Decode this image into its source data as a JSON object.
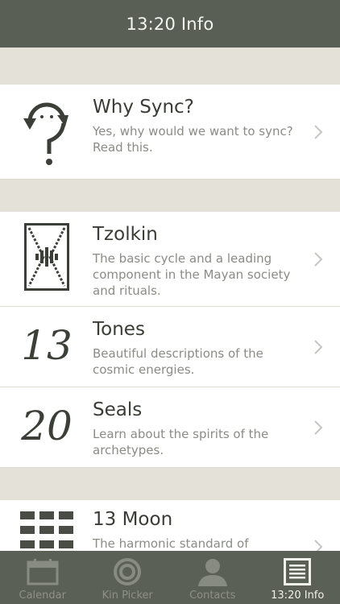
{
  "navbar": {
    "title": "13:20 Info"
  },
  "rows": [
    {
      "title": "Why Sync?",
      "desc": "Yes, why would we want to sync? Read this.",
      "icon": "sync-question-icon"
    },
    {
      "title": "Tzolkin",
      "desc": "The basic cycle and a leading component in the Mayan society and rituals.",
      "icon": "tzolkin-glyph-icon"
    },
    {
      "title": "Tones",
      "desc": "Beautiful descriptions of the cosmic energies.",
      "icon_text": "13"
    },
    {
      "title": "Seals",
      "desc": "Learn about the spirits of the archetypes.",
      "icon_text": "20"
    },
    {
      "title": "13 Moon",
      "desc": "The harmonic standard of",
      "icon": "calendar-grid-icon"
    }
  ],
  "tabs": [
    {
      "label": "Calendar",
      "icon": "calendar-icon",
      "active": false
    },
    {
      "label": "Kin Picker",
      "icon": "kin-picker-icon",
      "active": false
    },
    {
      "label": "Contacts",
      "icon": "contacts-icon",
      "active": false
    },
    {
      "label": "13:20 Info",
      "icon": "info-list-icon",
      "active": true
    }
  ],
  "colors": {
    "navbar": "#5a5f55",
    "tabbar": "#5b6056",
    "background": "#e4e2d9",
    "title_text": "#3a3d36",
    "desc_text": "#8a8c86"
  }
}
